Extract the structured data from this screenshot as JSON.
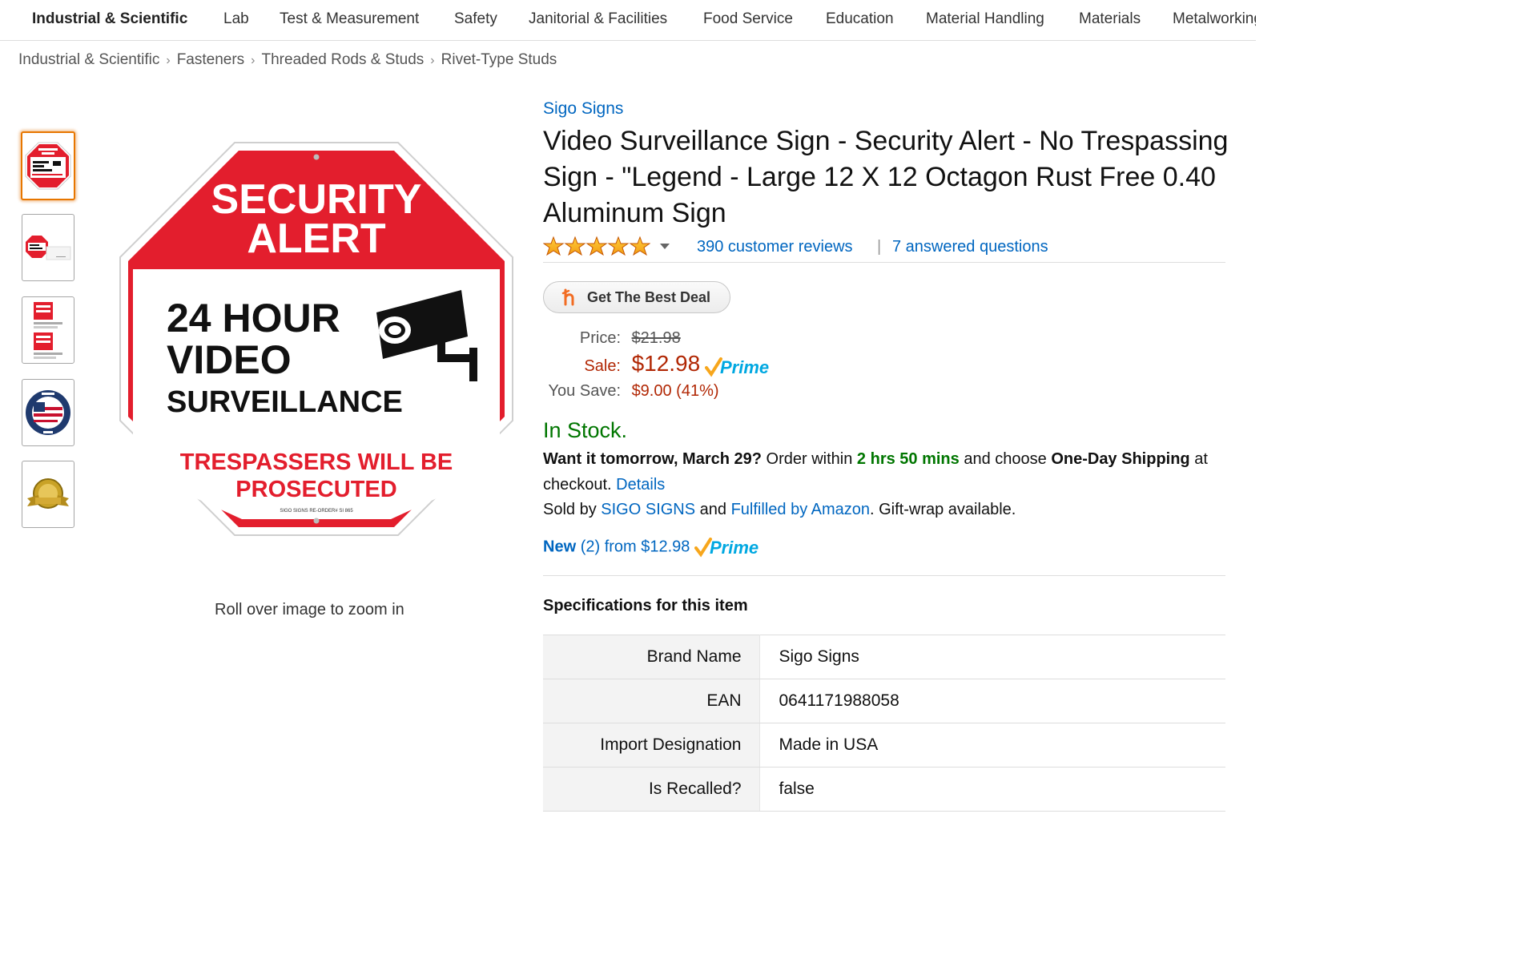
{
  "nav": {
    "store": "Industrial & Scientific",
    "items": [
      "Lab",
      "Test & Measurement",
      "Safety",
      "Janitorial & Facilities",
      "Food Service",
      "Education",
      "Material Handling",
      "Materials",
      "Metalworking"
    ]
  },
  "breadcrumb": [
    "Industrial & Scientific",
    "Fasteners",
    "Threaded Rods & Studs",
    "Rivet-Type Studs"
  ],
  "image": {
    "sign_line1": "SECURITY",
    "sign_line2": "ALERT",
    "sign_line3": "24 HOUR",
    "sign_line4": "VIDEO",
    "sign_line5": "SURVEILLANCE",
    "sign_line6": "TRESPASSERS WILL BE",
    "sign_line7": "PROSECUTED",
    "sign_fine_print": "SIGO SIGNS RE-ORDER# SI 865",
    "zoom_hint": "Roll over image to zoom in"
  },
  "product": {
    "brand": "Sigo Signs",
    "title": "Video Surveillance Sign - Security Alert - No Trespassing Sign - \"Legend - Large 12 X 12 Octagon Rust Free 0.40 Aluminum Sign",
    "rating_stars": 5,
    "reviews": "390 customer reviews",
    "separator": "|",
    "questions": "7 answered questions",
    "deal_button": "Get The Best Deal",
    "price_label": "Price:",
    "list_price": "$21.98",
    "sale_label": "Sale:",
    "sale_price": "$12.98",
    "prime": "Prime",
    "save_label": "You Save:",
    "save_value": "$9.00 (41%)",
    "stock": "In Stock.",
    "delivery": {
      "want": "Want it tomorrow, March 29?",
      "order_within": "Order within",
      "time": "2 hrs 50 mins",
      "and_choose": "and choose",
      "one_day": "One-Day Shipping",
      "at_checkout": "at checkout.",
      "details": "Details"
    },
    "sold_by": {
      "prefix": "Sold by",
      "seller": "SIGO SIGNS",
      "and": "and",
      "fulfilled": "Fulfilled by Amazon",
      "suffix": ". Gift-wrap available."
    },
    "new_offers": {
      "new": "New",
      "count": "(2)",
      "from": "from $12.98"
    }
  },
  "specs": {
    "title": "Specifications for this item",
    "rows": [
      {
        "key": "Brand Name",
        "value": "Sigo Signs"
      },
      {
        "key": "EAN",
        "value": "0641171988058"
      },
      {
        "key": "Import Designation",
        "value": "Made in USA"
      },
      {
        "key": "Is Recalled?",
        "value": "false"
      }
    ]
  },
  "colors": {
    "link": "#0066c0",
    "price_red": "#b12704",
    "stock_green": "#007600",
    "star_orange": "#ffa41c",
    "sign_red": "#e31e2d",
    "thumb_active": "#e77600"
  }
}
